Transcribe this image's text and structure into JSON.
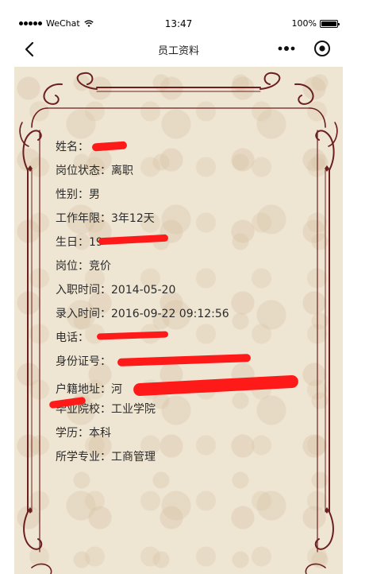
{
  "status_bar": {
    "carrier": "WeChat",
    "time": "13:47",
    "battery": "100%",
    "battery_level": 1.0
  },
  "nav": {
    "title": "员工资料",
    "back_icon": "chevron-left-icon",
    "menu_icon": "more-dots-icon",
    "close_icon": "target-close-icon"
  },
  "profile": {
    "rows": [
      {
        "label": "姓名：",
        "value": ""
      },
      {
        "label": "岗位状态：",
        "value": "离职"
      },
      {
        "label": "性别：",
        "value": "男"
      },
      {
        "label": "工作年限：",
        "value": "3年12天"
      },
      {
        "label": "生日：",
        "value": "19"
      },
      {
        "label": "岗位：",
        "value": "竞价"
      },
      {
        "label": "入职时间：",
        "value": "2014-05-20"
      },
      {
        "label": "录入时间：",
        "value": "2016-09-22 09:12:56"
      },
      {
        "label": "电话：",
        "value": ""
      },
      {
        "label": "身份证号：",
        "value": ""
      },
      {
        "label": "户籍地址：",
        "value": "河"
      },
      {
        "label": "毕业院校：",
        "value": "工业学院"
      },
      {
        "label": "学历：",
        "value": "本科"
      },
      {
        "label": "所学专业：",
        "value": "工商管理"
      }
    ]
  },
  "colors": {
    "background": "#efe5d3",
    "frame": "#6b1f1f",
    "redaction": "#ff1a1a",
    "text": "#2b2b2b"
  }
}
